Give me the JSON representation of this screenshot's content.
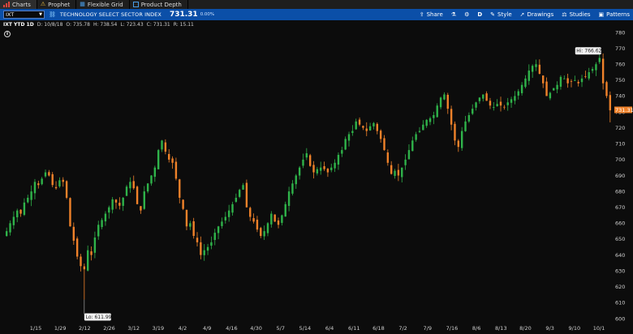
{
  "tabs": [
    {
      "label": "Charts",
      "icon": "bar-chart-icon",
      "active": true
    },
    {
      "label": "Prophet",
      "icon": "warning-icon",
      "active": false
    },
    {
      "label": "Flexible Grid",
      "icon": "grid-icon",
      "active": false
    },
    {
      "label": "Product Depth",
      "icon": "depth-icon",
      "active": false
    }
  ],
  "toolbar": {
    "symbol": "IXT",
    "link_icon": "link-icon",
    "description": "TECHNOLOGY SELECT SECTOR INDEX",
    "price": "731.31",
    "change": "0.00%",
    "share_label": "Share",
    "aggregation_label": "D",
    "style_label": "Style",
    "drawings_label": "Drawings",
    "studies_label": "Studies",
    "patterns_label": "Patterns"
  },
  "infobar": {
    "title": "IXT YTD 1D",
    "date": "D: 10/8/18",
    "open": "O: 735.78",
    "high": "H: 738.54",
    "low": "L: 723.43",
    "close": "C: 731.31",
    "range": "R: 15.11"
  },
  "colors": {
    "up": "#2fb34a",
    "down": "#f0822a",
    "background": "#0c0c0c",
    "toolbar": "#0b4fa8"
  },
  "chart_data": {
    "type": "candlestick",
    "y_axis": {
      "min": 600,
      "max": 780,
      "step": 10
    },
    "y_ticks": [
      "780",
      "770",
      "760",
      "750",
      "740",
      "730",
      "720",
      "710",
      "700",
      "690",
      "680",
      "670",
      "660",
      "650",
      "640",
      "630",
      "620",
      "610",
      "600"
    ],
    "x_labels": [
      "1/15",
      "1/29",
      "2/12",
      "2/26",
      "3/12",
      "3/19",
      "4/2",
      "4/9",
      "4/16",
      "4/30",
      "5/7",
      "5/14",
      "6/4",
      "6/11",
      "6/18",
      "7/2",
      "7/9",
      "7/16",
      "8/6",
      "8/13",
      "8/20",
      "9/3",
      "9/10",
      "10/1"
    ],
    "high_callout": "Hi: 766.62",
    "low_callout": "Lo: 611.99",
    "last_price": "731.31",
    "high_value": 766.62,
    "low_value": 611.99,
    "last_value": 731.31,
    "closes": [
      655,
      660,
      664,
      668,
      666,
      673,
      676,
      680,
      686,
      684,
      688,
      692,
      690,
      684,
      682,
      687,
      686,
      676,
      658,
      649,
      639,
      633,
      631,
      643,
      640,
      651,
      659,
      662,
      666,
      670,
      675,
      673,
      671,
      676,
      683,
      686,
      682,
      672,
      668,
      680,
      685,
      690,
      695,
      706,
      712,
      705,
      700,
      698,
      688,
      676,
      669,
      658,
      660,
      652,
      648,
      640,
      643,
      645,
      648,
      654,
      658,
      661,
      664,
      668,
      672,
      676,
      681,
      684,
      670,
      664,
      661,
      656,
      652,
      655,
      660,
      666,
      661,
      659,
      665,
      672,
      680,
      685,
      690,
      695,
      700,
      704,
      696,
      692,
      694,
      695,
      694,
      692,
      695,
      698,
      703,
      706,
      713,
      716,
      718,
      724,
      722,
      720,
      718,
      721,
      723,
      718,
      713,
      706,
      698,
      691,
      693,
      690,
      695,
      700,
      706,
      712,
      716,
      718,
      722,
      725,
      726,
      728,
      734,
      739,
      741,
      732,
      722,
      712,
      708,
      718,
      724,
      728,
      732,
      736,
      739,
      741,
      737,
      734,
      733,
      735,
      734,
      733,
      736,
      738,
      740,
      743,
      747,
      751,
      756,
      759,
      760,
      754,
      748,
      740,
      742,
      745,
      747,
      752,
      751,
      748,
      749,
      750,
      748,
      751,
      752,
      755,
      757,
      760,
      764,
      748,
      740,
      731
    ]
  }
}
